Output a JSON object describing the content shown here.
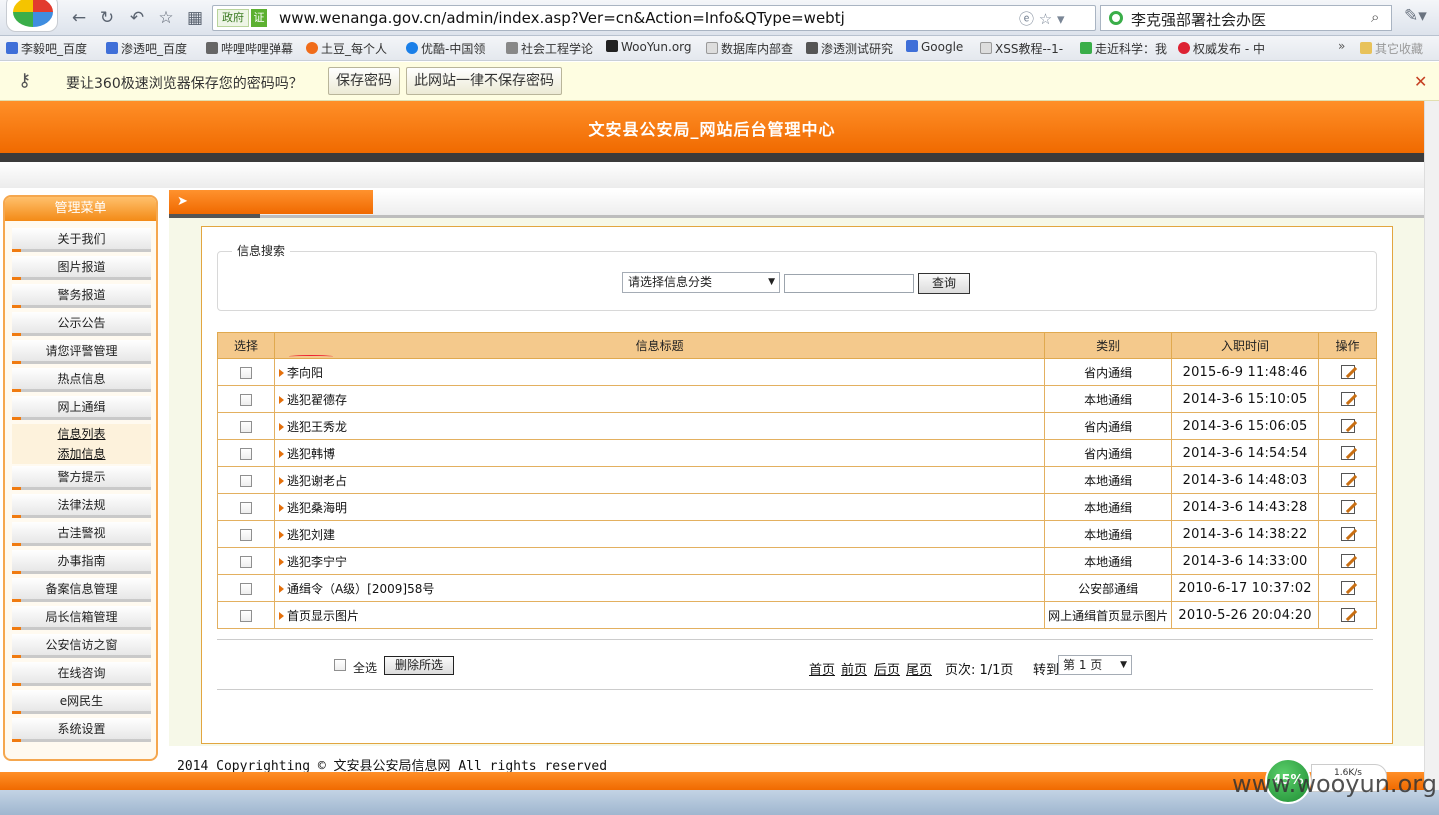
{
  "browser": {
    "address_tags": {
      "gov": "政府",
      "verified": "证"
    },
    "url": "www.wenanga.gov.cn/admin/index.asp?Ver=cn&Action=Info&QType=webtj",
    "search_text": "李克强部署社会办医",
    "bookmarks": [
      "李毅吧_百度",
      "渗透吧_百度",
      "哔哩哔哩弹幕",
      "土豆_每个人",
      "优酷-中国领",
      "社会工程学论",
      "WooYun.org",
      "数据库内部查",
      "渗透测试研究",
      "Google",
      "XSS教程--1-",
      "走近科学：我",
      "权威发布 - 中"
    ],
    "bookmarks_more": "»",
    "bookmarks_other": "其它收藏",
    "password_prompt": {
      "text": "要让360极速浏览器保存您的密码吗？",
      "save_label": "保存密码",
      "never_label": "此网站一律不保存密码"
    }
  },
  "site": {
    "title": "文安县公安局_网站后台管理中心"
  },
  "menu": {
    "header": "管理菜单",
    "items_top": [
      "关于我们",
      "图片报道",
      "警务报道",
      "公示公告",
      "请您评警管理",
      "热点信息",
      "网上通缉"
    ],
    "sub_items": [
      "信息列表",
      "添加信息"
    ],
    "items_bottom": [
      "警方提示",
      "法律法规",
      "古洼警视",
      "办事指南",
      "备案信息管理",
      "局长信箱管理",
      "公安信访之窗",
      "在线咨询",
      "e网民生",
      "系统设置"
    ]
  },
  "search": {
    "legend": "信息搜索",
    "category_placeholder": "请选择信息分类",
    "query_label": "查询"
  },
  "table": {
    "headers": [
      "选择",
      "信息标题",
      "类别",
      "入职时间",
      "操作"
    ],
    "rows": [
      {
        "title": "李向阳",
        "category": "省内通缉",
        "time": "2015-6-9 11:48:46"
      },
      {
        "title": "逃犯翟德存",
        "category": "本地通缉",
        "time": "2014-3-6 15:10:05"
      },
      {
        "title": "逃犯王秀龙",
        "category": "省内通缉",
        "time": "2014-3-6 15:06:05"
      },
      {
        "title": "逃犯韩博",
        "category": "省内通缉",
        "time": "2014-3-6 14:54:54"
      },
      {
        "title": "逃犯谢老占",
        "category": "本地通缉",
        "time": "2014-3-6 14:48:03"
      },
      {
        "title": "逃犯桑海明",
        "category": "本地通缉",
        "time": "2014-3-6 14:43:28"
      },
      {
        "title": "逃犯刘建",
        "category": "本地通缉",
        "time": "2014-3-6 14:38:22"
      },
      {
        "title": "逃犯李宁宁",
        "category": "本地通缉",
        "time": "2014-3-6 14:33:00"
      },
      {
        "title": "通缉令（A级）[2009]58号",
        "category": "公安部通缉",
        "time": "2010-6-17 10:37:02"
      },
      {
        "title": "首页显示图片",
        "category": "网上通缉首页显示图片",
        "time": "2010-5-26 20:04:20"
      }
    ]
  },
  "actions": {
    "select_all": "全选",
    "delete_selected": "删除所选"
  },
  "pagination": {
    "first": "首页",
    "prev": "前页",
    "next": "后页",
    "last": "尾页",
    "page_info": "页次: 1/1页",
    "goto": "转到",
    "page_select": "第 1 页"
  },
  "footer": {
    "copyright": "2014 Copyrighting © 文安县公安局信息网 All rights reserved"
  },
  "overlay": {
    "speed_percent": "45%",
    "speed_rate": "1.6K/s",
    "watermark": "www.wooyun.org"
  },
  "colors": {
    "accent_orange": "#f06a00",
    "table_header": "#f4c98c",
    "border_gold": "#e2a640"
  }
}
